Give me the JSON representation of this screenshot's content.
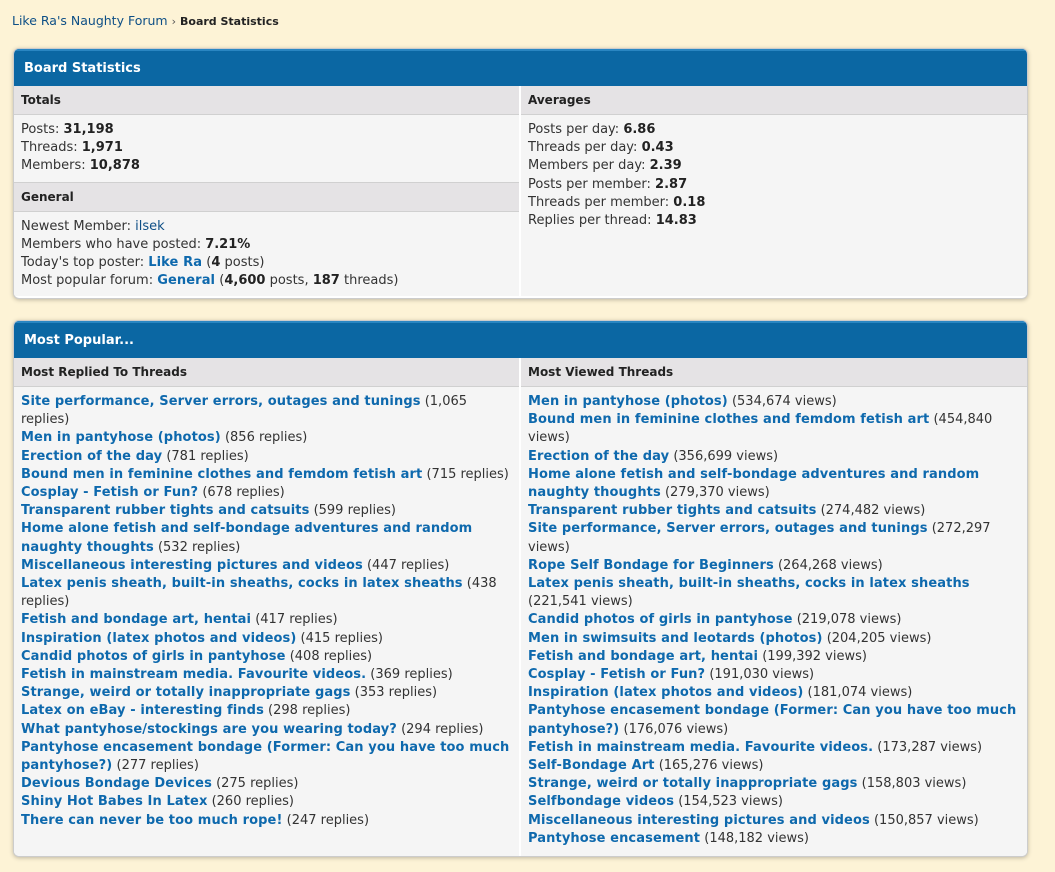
{
  "breadcrumb": {
    "home": "Like Ra's Naughty Forum",
    "sep": "›",
    "current": "Board Statistics"
  },
  "stats": {
    "title": "Board Statistics",
    "totals": {
      "heading": "Totals",
      "posts_label": "Posts: ",
      "posts": "31,198",
      "threads_label": "Threads: ",
      "threads": "1,971",
      "members_label": "Members: ",
      "members": "10,878"
    },
    "general": {
      "heading": "General",
      "newest_label": "Newest Member: ",
      "newest": "ilsek",
      "posted_label": "Members who have posted: ",
      "posted": "7.21%",
      "top_label": "Today's top poster: ",
      "top_poster": "Like Ra",
      "top_open": " (",
      "top_count": "4",
      "top_suffix": " posts)",
      "popular_label": "Most popular forum: ",
      "popular_forum": "General",
      "popular_open": " (",
      "popular_posts": "4,600",
      "popular_mid": " posts, ",
      "popular_threads": "187",
      "popular_suffix": " threads)"
    },
    "averages": {
      "heading": "Averages",
      "rows": [
        {
          "label": "Posts per day: ",
          "value": "6.86"
        },
        {
          "label": "Threads per day: ",
          "value": "0.43"
        },
        {
          "label": "Members per day: ",
          "value": "2.39"
        },
        {
          "label": "Posts per member: ",
          "value": "2.87"
        },
        {
          "label": "Threads per member: ",
          "value": "0.18"
        },
        {
          "label": "Replies per thread: ",
          "value": "14.83"
        }
      ]
    }
  },
  "popular": {
    "title": "Most Popular...",
    "replied": {
      "heading": "Most Replied To Threads",
      "items": [
        {
          "title": "Site performance, Server errors, outages and tunings",
          "count": "(1,065 replies)"
        },
        {
          "title": "Men in pantyhose (photos)",
          "count": "(856 replies)"
        },
        {
          "title": "Erection of the day",
          "count": "(781 replies)"
        },
        {
          "title": "Bound men in feminine clothes and femdom fetish art",
          "count": "(715 replies)"
        },
        {
          "title": "Cosplay - Fetish or Fun?",
          "count": "(678 replies)"
        },
        {
          "title": "Transparent rubber tights and catsuits",
          "count": "(599 replies)"
        },
        {
          "title": "Home alone fetish and self-bondage adventures and random naughty thoughts",
          "count": "(532 replies)"
        },
        {
          "title": "Miscellaneous interesting pictures and videos",
          "count": "(447 replies)"
        },
        {
          "title": "Latex penis sheath, built-in sheaths, cocks in latex sheaths",
          "count": "(438 replies)"
        },
        {
          "title": "Fetish and bondage art, hentai",
          "count": "(417 replies)"
        },
        {
          "title": "Inspiration (latex photos and videos)",
          "count": "(415 replies)"
        },
        {
          "title": "Candid photos of girls in pantyhose",
          "count": "(408 replies)"
        },
        {
          "title": "Fetish in mainstream media. Favourite videos.",
          "count": "(369 replies)"
        },
        {
          "title": "Strange, weird or totally inappropriate gags",
          "count": "(353 replies)"
        },
        {
          "title": "Latex on eBay - interesting finds",
          "count": "(298 replies)"
        },
        {
          "title": "What pantyhose/stockings are you wearing today?",
          "count": "(294 replies)"
        },
        {
          "title": "Pantyhose encasement bondage (Former: Can you have too much pantyhose?)",
          "count": "(277 replies)"
        },
        {
          "title": "Devious Bondage Devices",
          "count": "(275 replies)"
        },
        {
          "title": "Shiny Hot Babes In Latex",
          "count": "(260 replies)"
        },
        {
          "title": "There can never be too much rope!",
          "count": "(247 replies)"
        }
      ]
    },
    "viewed": {
      "heading": "Most Viewed Threads",
      "items": [
        {
          "title": "Men in pantyhose (photos)",
          "count": "(534,674 views)"
        },
        {
          "title": "Bound men in feminine clothes and femdom fetish art",
          "count": "(454,840 views)"
        },
        {
          "title": "Erection of the day",
          "count": "(356,699 views)"
        },
        {
          "title": "Home alone fetish and self-bondage adventures and random naughty thoughts",
          "count": "(279,370 views)"
        },
        {
          "title": "Transparent rubber tights and catsuits",
          "count": "(274,482 views)"
        },
        {
          "title": "Site performance, Server errors, outages and tunings",
          "count": "(272,297 views)"
        },
        {
          "title": "Rope Self Bondage for Beginners",
          "count": "(264,268 views)"
        },
        {
          "title": "Latex penis sheath, built-in sheaths, cocks in latex sheaths",
          "count": "(221,541 views)"
        },
        {
          "title": "Candid photos of girls in pantyhose",
          "count": "(219,078 views)"
        },
        {
          "title": "Men in swimsuits and leotards (photos)",
          "count": "(204,205 views)"
        },
        {
          "title": "Fetish and bondage art, hentai",
          "count": "(199,392 views)"
        },
        {
          "title": "Cosplay - Fetish or Fun?",
          "count": "(191,030 views)"
        },
        {
          "title": "Inspiration (latex photos and videos)",
          "count": "(181,074 views)"
        },
        {
          "title": "Pantyhose encasement bondage (Former: Can you have too much pantyhose?)",
          "count": "(176,076 views)"
        },
        {
          "title": "Fetish in mainstream media. Favourite videos.",
          "count": "(173,287 views)"
        },
        {
          "title": "Self-Bondage Art",
          "count": "(165,276 views)"
        },
        {
          "title": "Strange, weird or totally inappropriate gags",
          "count": "(158,803 views)"
        },
        {
          "title": "Selfbondage videos",
          "count": "(154,523 views)"
        },
        {
          "title": "Miscellaneous interesting pictures and videos",
          "count": "(150,857 views)"
        },
        {
          "title": "Pantyhose encasement",
          "count": "(148,182 views)"
        }
      ]
    }
  }
}
